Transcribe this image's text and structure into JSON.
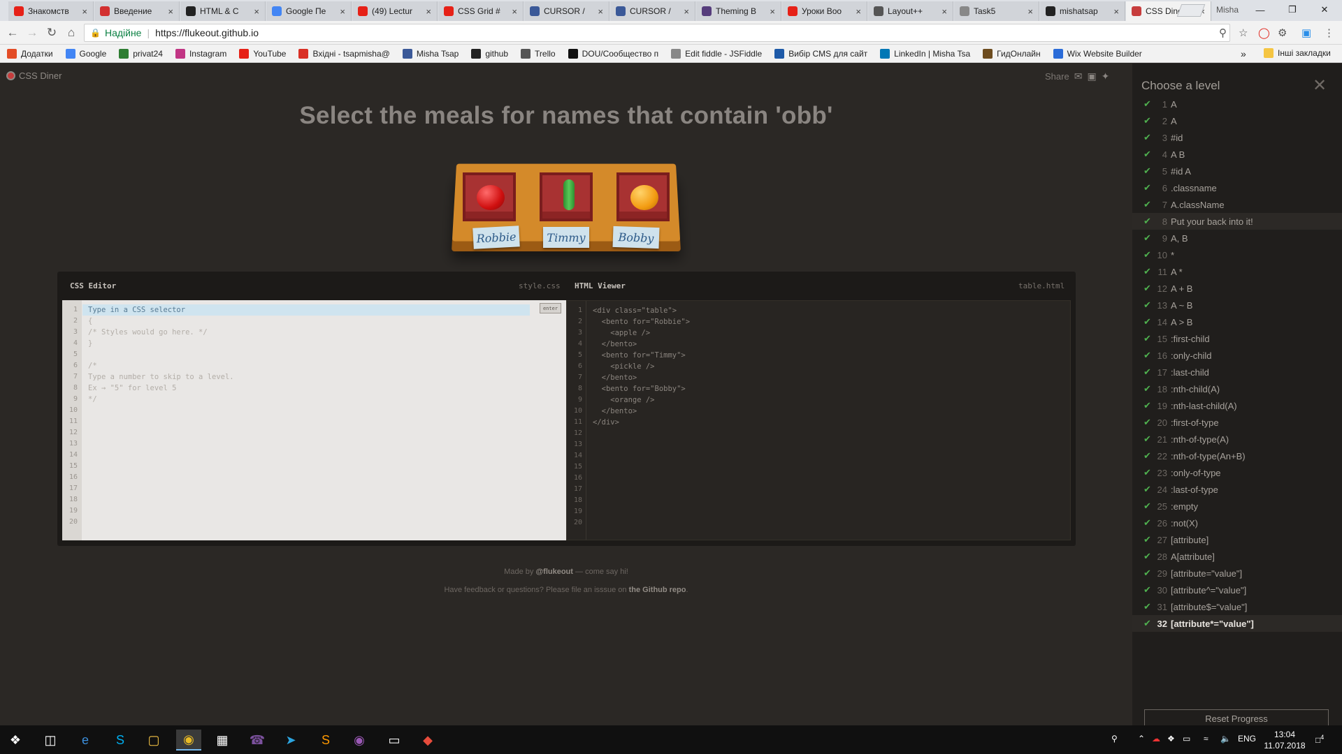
{
  "browser": {
    "tabs": [
      {
        "title": "Знакомств",
        "icon": "youtube-icon",
        "color": "#e62117"
      },
      {
        "title": "Введение",
        "icon": "figure-icon",
        "color": "#d23030"
      },
      {
        "title": "HTML & C",
        "icon": "github-icon",
        "color": "#222222"
      },
      {
        "title": "Google Пе",
        "icon": "google-translate-icon",
        "color": "#4285f4"
      },
      {
        "title": "(49) Lectur",
        "icon": "youtube-icon",
        "color": "#e62117"
      },
      {
        "title": "CSS Grid #",
        "icon": "youtube-icon",
        "color": "#e62117"
      },
      {
        "title": "CURSOR /",
        "icon": "facebook-icon",
        "color": "#3b5998"
      },
      {
        "title": "CURSOR /",
        "icon": "facebook-icon",
        "color": "#3b5998"
      },
      {
        "title": "Theming B",
        "icon": "bootstrap-icon",
        "color": "#563d7c"
      },
      {
        "title": "Уроки Boo",
        "icon": "youtube-icon",
        "color": "#e62117"
      },
      {
        "title": "Layout++",
        "icon": "smiley-icon",
        "color": "#555555"
      },
      {
        "title": "Task5",
        "icon": "document-icon",
        "color": "#888888"
      },
      {
        "title": "mishatsap",
        "icon": "github-icon",
        "color": "#222222"
      },
      {
        "title": "CSS Diner",
        "icon": "css-diner-icon",
        "color": "#c73d3d",
        "active": true
      }
    ],
    "profile": "Misha",
    "address": {
      "secure_label": "Надійне",
      "url": "https://flukeout.github.io"
    },
    "bookmarks": [
      {
        "label": "Додатки",
        "icon": "apps-icon",
        "color": "#e34c26"
      },
      {
        "label": "Google",
        "icon": "google-icon",
        "color": "#4285f4"
      },
      {
        "label": "privat24",
        "icon": "privat24-icon",
        "color": "#2e7d32"
      },
      {
        "label": "Instagram",
        "icon": "instagram-icon",
        "color": "#c13584"
      },
      {
        "label": "YouTube",
        "icon": "youtube-icon",
        "color": "#e62117"
      },
      {
        "label": "Вхідні - tsapmisha@",
        "icon": "gmail-icon",
        "color": "#d93025"
      },
      {
        "label": "Misha Tsap",
        "icon": "facebook-icon",
        "color": "#3b5998"
      },
      {
        "label": "github",
        "icon": "github-icon",
        "color": "#222222"
      },
      {
        "label": "Trello",
        "icon": "trello-icon",
        "color": "#555555"
      },
      {
        "label": "DOU/Сообщество п",
        "icon": "dou-icon",
        "color": "#111111"
      },
      {
        "label": "Edit fiddle - JSFiddle",
        "icon": "document-icon",
        "color": "#888888"
      },
      {
        "label": "Вибір CMS для сайт",
        "icon": "wb-icon",
        "color": "#1e5aa8"
      },
      {
        "label": "LinkedIn | Misha Tsa",
        "icon": "linkedin-icon",
        "color": "#0077b5"
      },
      {
        "label": "ГидОнлайн",
        "icon": "gidonline-icon",
        "color": "#6d4c1f"
      },
      {
        "label": "Wix Website Builder",
        "icon": "wix-icon",
        "color": "#2b6cd8"
      }
    ],
    "other_bookmarks": "Інші закладки"
  },
  "app": {
    "logo": "CSS Diner",
    "share_label": "Share",
    "order": "Select the meals for names that contain 'obb'",
    "bentos": [
      {
        "name": "Robbie",
        "food": "apple"
      },
      {
        "name": "Timmy",
        "food": "pickle"
      },
      {
        "name": "Bobby",
        "food": "orange"
      }
    ],
    "css_editor": {
      "title": "CSS Editor",
      "file": "style.css",
      "placeholder": "Type in a CSS selector",
      "enter_label": "enter",
      "lines": [
        "{",
        "/* Styles would go here. */",
        "}",
        "",
        "/*",
        "Type a number to skip to a level.",
        "Ex → \"5\" for level 5",
        "*/"
      ]
    },
    "html_viewer": {
      "title": "HTML Viewer",
      "file": "table.html",
      "lines": [
        "<div class=\"table\">",
        "  <bento for=\"Robbie\">",
        "    <apple />",
        "  </bento>",
        "  <bento for=\"Timmy\">",
        "    <pickle />",
        "  </bento>",
        "  <bento for=\"Bobby\">",
        "    <orange />",
        "  </bento>",
        "</div>"
      ]
    },
    "footer": {
      "made_by_prefix": "Made by",
      "made_by_handle": "@flukeout",
      "made_by_suffix": "— come say hi!",
      "feedback_prefix": "Have feedback or questions? Please file an isssue on",
      "feedback_link": "the Github repo",
      "feedback_suffix": "."
    },
    "levels_panel": {
      "title": "Choose a level",
      "reset_label": "Reset Progress",
      "levels": [
        {
          "n": "1",
          "name": "A"
        },
        {
          "n": "2",
          "name": "A"
        },
        {
          "n": "3",
          "name": "#id"
        },
        {
          "n": "4",
          "name": "A B"
        },
        {
          "n": "5",
          "name": "#id A"
        },
        {
          "n": "6",
          "name": ".classname"
        },
        {
          "n": "7",
          "name": "A.className"
        },
        {
          "n": "8",
          "name": "Put your back into it!",
          "hover": true
        },
        {
          "n": "9",
          "name": "A, B"
        },
        {
          "n": "10",
          "name": "*"
        },
        {
          "n": "11",
          "name": "A *"
        },
        {
          "n": "12",
          "name": "A + B"
        },
        {
          "n": "13",
          "name": "A ~ B"
        },
        {
          "n": "14",
          "name": "A > B"
        },
        {
          "n": "15",
          "name": ":first-child"
        },
        {
          "n": "16",
          "name": ":only-child"
        },
        {
          "n": "17",
          "name": ":last-child"
        },
        {
          "n": "18",
          "name": ":nth-child(A)"
        },
        {
          "n": "19",
          "name": ":nth-last-child(A)"
        },
        {
          "n": "20",
          "name": ":first-of-type"
        },
        {
          "n": "21",
          "name": ":nth-of-type(A)"
        },
        {
          "n": "22",
          "name": ":nth-of-type(An+B)"
        },
        {
          "n": "23",
          "name": ":only-of-type"
        },
        {
          "n": "24",
          "name": ":last-of-type"
        },
        {
          "n": "25",
          "name": ":empty"
        },
        {
          "n": "26",
          "name": ":not(X)"
        },
        {
          "n": "27",
          "name": "[attribute]"
        },
        {
          "n": "28",
          "name": "A[attribute]"
        },
        {
          "n": "29",
          "name": "[attribute=\"value\"]"
        },
        {
          "n": "30",
          "name": "[attribute^=\"value\"]"
        },
        {
          "n": "31",
          "name": "[attribute$=\"value\"]"
        },
        {
          "n": "32",
          "name": "[attribute*=\"value\"]",
          "current": true
        }
      ]
    }
  },
  "taskbar": {
    "language": "ENG",
    "time": "13:04",
    "date": "11.07.2018",
    "notifications": "4"
  }
}
